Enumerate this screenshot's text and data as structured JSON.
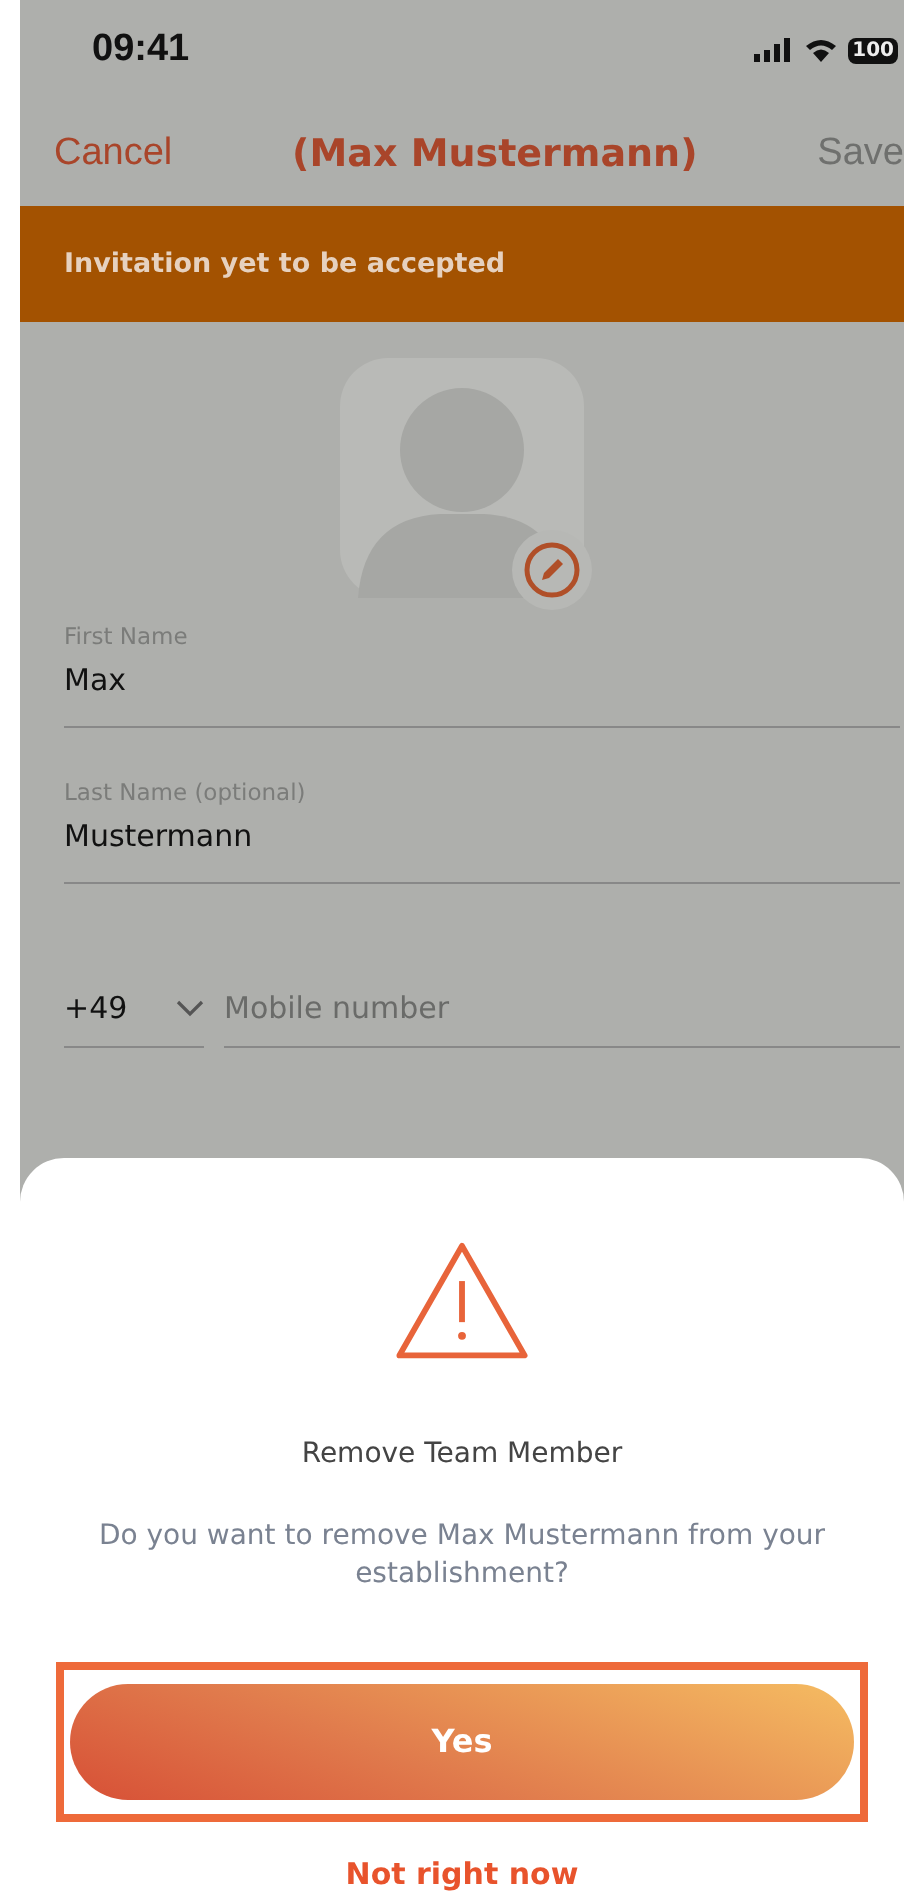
{
  "status_bar": {
    "time": "09:41",
    "battery": "100"
  },
  "nav": {
    "cancel": "Cancel",
    "title": "(Max Mustermann)",
    "save": {
      "label": "Save",
      "disabled": true
    }
  },
  "banner": "Invitation yet to be accepted",
  "fields": [
    {
      "kind": "text",
      "label": "First Name",
      "value": "Max"
    },
    {
      "kind": "text",
      "label": "Last Name (optional)",
      "value": "Mustermann"
    },
    {
      "kind": "phone",
      "code": "+49",
      "placeholder": "Mobile number"
    }
  ],
  "dialog": {
    "title": "Remove Team Member",
    "message": "Do you want to remove Max Mustermann from your establishment?",
    "confirm": {
      "label": "Yes",
      "highlighted": true
    },
    "dismiss": "Not right now"
  }
}
